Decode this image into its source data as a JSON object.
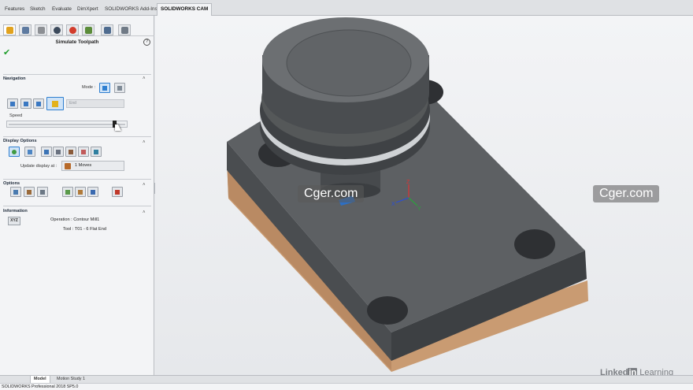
{
  "command_tabs": [
    "Features",
    "Sketch",
    "Evaluate",
    "DimXpert",
    "SOLIDWORKS Add-Ins",
    "SOLIDWORKS CAM"
  ],
  "active_tab": "SOLIDWORKS CAM",
  "panel": {
    "title": "Simulate Toolpath",
    "help_glyph": "?",
    "ok_glyph": "✔",
    "navigation": {
      "title": "Navigation",
      "mode_label": "Mode :",
      "end_field": "End",
      "speed_label": "Speed",
      "speed_level": 0.92
    },
    "display_options": {
      "title": "Display Options",
      "update_label": "Update display at :",
      "update_value": "1 Moves"
    },
    "options": {
      "title": "Options"
    },
    "information": {
      "title": "Information",
      "xyz_label": "XYZ",
      "operation": "Operation :  Contour Mill1",
      "tool": "Tool :  T01 - 6 Flat End"
    },
    "collapse_glyph": "˄",
    "grip_glyph": "›"
  },
  "watermarks": [
    "Cger.com",
    "Cger.com"
  ],
  "triad": {
    "x": "X",
    "y": "Y",
    "z": "Z"
  },
  "brand": {
    "part1": "Linked",
    "part2": "in",
    "part3": " Learning"
  },
  "bottom_tabs": [
    "Model",
    "Motion Study 1"
  ],
  "active_bottom_tab": "Model",
  "status_text": "SOLIDWORKS Professional 2018 SP5.0",
  "colors": {
    "accent_blue": "#2f7fd0",
    "ok_green": "#1f9d2b",
    "part_dark": "#5d6063",
    "stock_tan": "#c99b72"
  }
}
